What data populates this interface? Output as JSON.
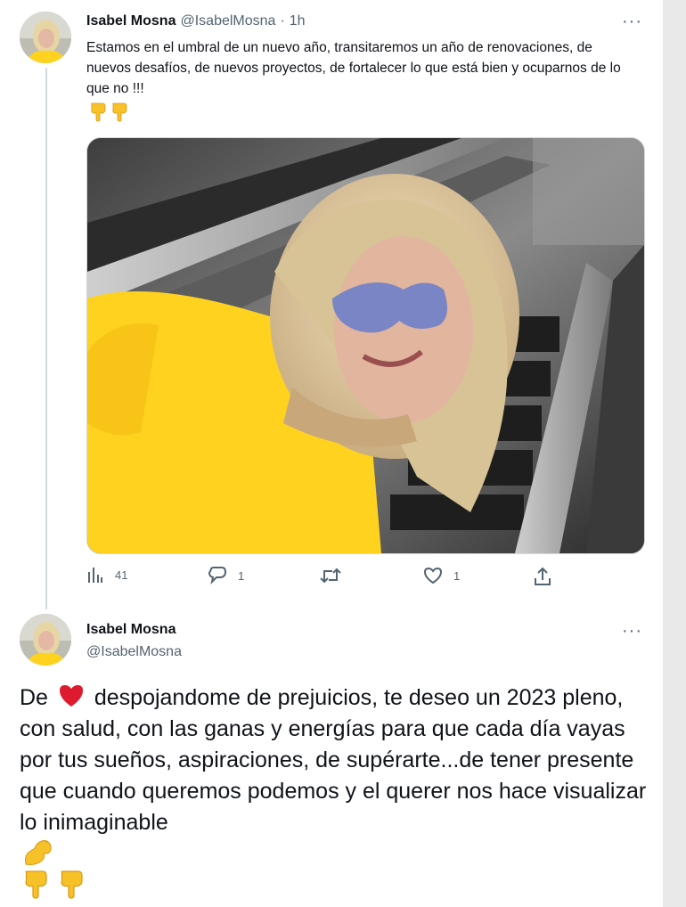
{
  "tweet1": {
    "author_name": "Isabel Mosna",
    "handle": "@IsabelMosna",
    "separator": "·",
    "time": "1h",
    "more": "···",
    "text": "Estamos en el umbral de un nuevo año, transitaremos un año de renovaciones, de nuevos desafíos, de nuevos proyectos, de fortalecer lo que está bien y ocuparnos de lo que no !!!",
    "emojis": [
      "pointing-down-icon",
      "pointing-down-icon"
    ],
    "actions": {
      "views_count": "41",
      "reply_count": "1",
      "retweet_count": "",
      "like_count": "1"
    }
  },
  "tweet2": {
    "author_name": "Isabel Mosna",
    "handle": "@IsabelMosna",
    "more": "···",
    "text_before_heart": "De",
    "text_after_heart": "despojandome de prejuicios, te deseo un 2023 pleno, con salud, con las ganas y energías para que cada día vayas por tus sueños, aspiraciones, de supérarte...de tener presente que cuando queremos podemos y el querer nos hace visualizar lo inimaginable",
    "emojis": [
      "flexed-biceps-icon",
      "pointing-down-icon",
      "pointing-down-icon"
    ]
  },
  "colors": {
    "text": "#0f1419",
    "muted": "#536471",
    "heart": "#dd1a2e",
    "emoji_yellow": "#f7c12a",
    "shirt_yellow": "#ffd21f"
  }
}
